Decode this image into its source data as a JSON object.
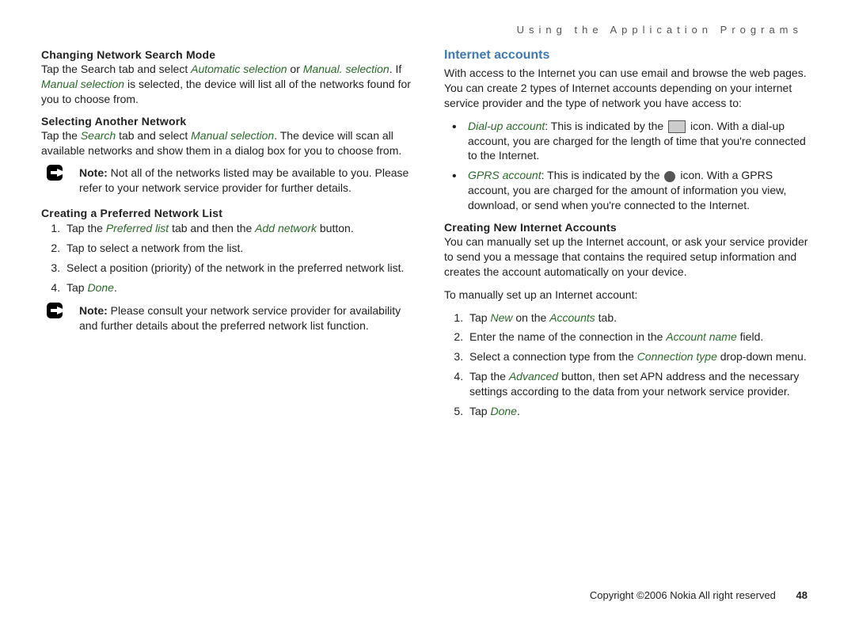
{
  "runningHeader": "Using the Application Programs",
  "left": {
    "h1": "Changing Network Search Mode",
    "p1a": "Tap the Search tab and select ",
    "p1e1": "Automatic selection",
    "p1b": " or ",
    "p1e2": "Manual. selection",
    "p1c": ". If ",
    "p1e3": "Manual selection",
    "p1d": " is selected, the device will list all of the networks found for you to choose from.",
    "h2": "Selecting Another Network",
    "p2a": "Tap the ",
    "p2e1": "Search",
    "p2b": " tab and select ",
    "p2e2": "Manual selection",
    "p2c": ". The device will scan all available networks and show them in a dialog box for you to choose from.",
    "note1_label": "Note:",
    "note1_text": " Not all of the networks listed may be available to you. Please refer to your network service provider for further details.",
    "h3": "Creating a Preferred Network List",
    "ol1": {
      "i1a": "Tap the ",
      "i1e1": "Preferred list",
      "i1b": " tab and then the ",
      "i1e2": "Add network",
      "i1c": " button.",
      "i2": "Tap to select a network from the list.",
      "i3": "Select a position (priority) of the network in the preferred network list.",
      "i4a": "Tap ",
      "i4e1": "Done",
      "i4b": "."
    },
    "note2_label": "Note:",
    "note2_text": " Please consult your network service provider for availability and further details about the preferred network list function."
  },
  "right": {
    "h1": "Internet accounts",
    "p1": "With access to the Internet you can use email and browse the web pages. You can create 2 types of Internet accounts depending on your internet service provider and the type of network you have access to:",
    "b1e1": "Dial-up account",
    "b1a": ": This is indicated by the ",
    "b1b": " icon. With a dial-up account, you are charged for the length of time that you're connected to the Internet.",
    "b2e1": "GPRS account",
    "b2a": ": This is indicated by the ",
    "b2b": " icon. With a GPRS account, you are charged for the amount of information you view, download, or send when you're connected to the Internet.",
    "h2": "Creating New Internet Accounts",
    "p2": "You can manually set up the Internet account, or ask your service provider to send you a message that contains the required setup information and creates the account automatically on your device.",
    "p3": "To manually set up an Internet account:",
    "ol1": {
      "i1a": "Tap ",
      "i1e1": "New",
      "i1b": " on the ",
      "i1e2": "Accounts",
      "i1c": " tab.",
      "i2a": "Enter the name of the connection in the ",
      "i2e1": "Account name",
      "i2b": " field.",
      "i3a": "Select a connection type from the ",
      "i3e1": "Connection type",
      "i3b": " drop-down menu.",
      "i4a": "Tap the ",
      "i4e1": "Advanced",
      "i4b": " button, then set APN address and the necessary settings according to the data from your network service provider.",
      "i5a": "Tap ",
      "i5e1": "Done",
      "i5b": "."
    }
  },
  "footer": {
    "copyright": "Copyright ©2006 Nokia All right reserved",
    "page": "48"
  }
}
